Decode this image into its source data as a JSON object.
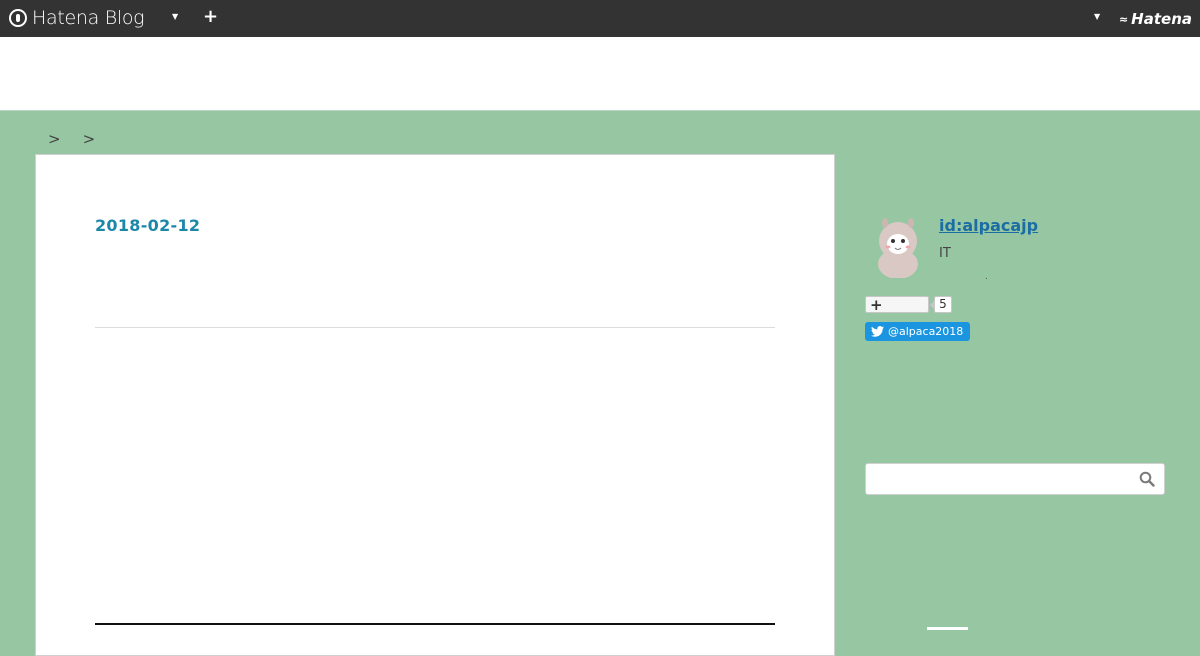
{
  "topbar": {
    "brand": "Hatena Blog",
    "add_label": "+",
    "hatena_label": "Hatena"
  },
  "breadcrumb": {
    "separator": ">"
  },
  "article": {
    "date": "2018-02-12"
  },
  "profile": {
    "id": "id:alpacajp",
    "description": "IT",
    "dot": ".",
    "follow_label": "+",
    "follow_count": "5",
    "twitter_label": "@alpaca2018"
  },
  "search": {
    "placeholder": ""
  },
  "colors": {
    "page_background": "#97c6a2",
    "topbar": "#333333",
    "link": "#1c87a8",
    "twitter": "#1b95e0"
  }
}
